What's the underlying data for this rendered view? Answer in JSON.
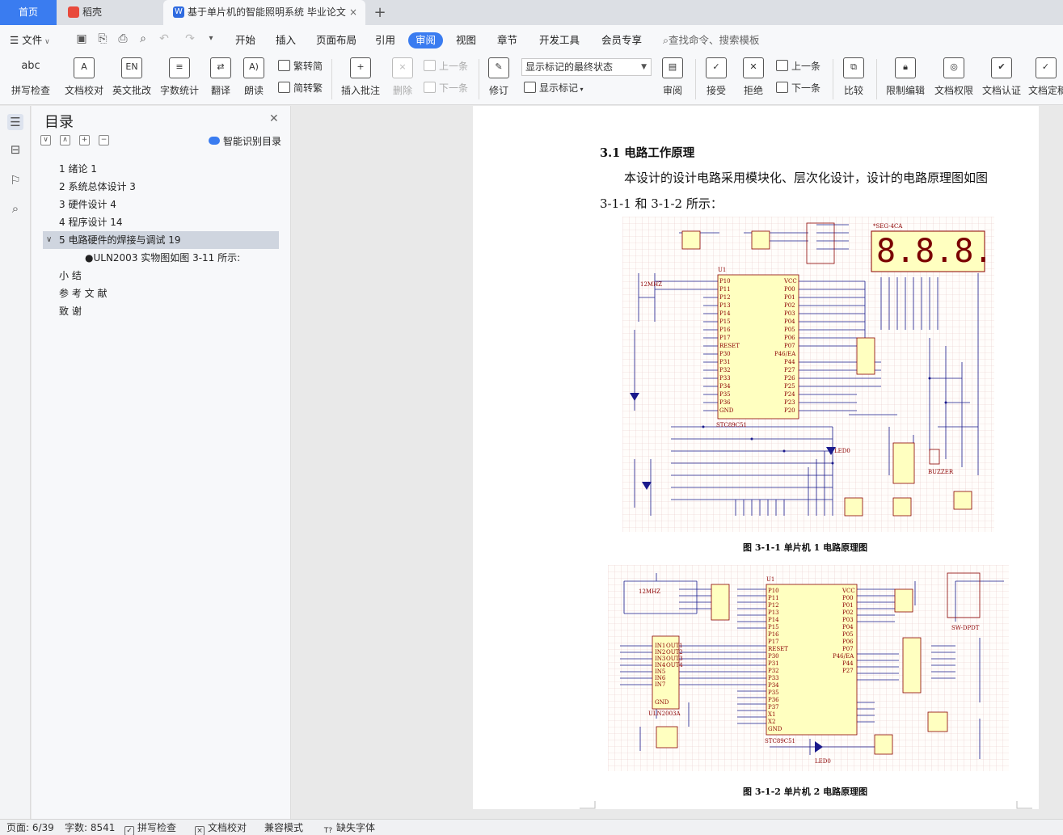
{
  "tabs": {
    "home": "首页",
    "daoke": "稻壳",
    "document": "基于单片机的智能照明系统 毕业论文",
    "close_glyph": "×",
    "add_glyph": "+"
  },
  "menu": {
    "file": "文件",
    "items": [
      "开始",
      "插入",
      "页面布局",
      "引用",
      "审阅",
      "视图",
      "章节",
      "开发工具",
      "会员专享"
    ],
    "active": "审阅",
    "search": "查找命令、搜索模板"
  },
  "ribbon": {
    "spellcheck": "拼写检查",
    "doc_proof": "文档校对",
    "en_proof": "英文批改",
    "word_count": "字数统计",
    "translate": "翻译",
    "read_aloud": "朗读",
    "trad_conv": "繁转简",
    "simp_conv": "简转繁",
    "insert_comment": "插入批注",
    "delete": "删除",
    "prev_comment": "上一条",
    "next_comment": "下一条",
    "revise": "修订",
    "markup_state": "显示标记的最终状态",
    "show_markup": "显示标记",
    "review": "审阅",
    "accept": "接受",
    "reject": "拒绝",
    "prev_change": "上一条",
    "next_change": "下一条",
    "compare": "比较",
    "restrict_edit": "限制编辑",
    "doc_permission": "文档权限",
    "doc_certify": "文档认证",
    "doc_finalize": "文档定稿"
  },
  "toc": {
    "title": "目录",
    "smart_detect": "智能识别目录",
    "items": [
      "1  绪论  1",
      "2  系统总体设计  3",
      "3  硬件设计  4",
      "4  程序设计  14",
      "5  电路硬件的焊接与调试  19",
      "●ULN2003 实物图如图 3-11 所示:",
      "小  结",
      "参  考  文  献",
      "致    谢"
    ]
  },
  "document": {
    "section_title": "3.1 电路工作原理",
    "para_line1": "本设计的设计电路采用模块化、层次化设计，设计的电路原理图如图",
    "para_line2": "3-1-1 和 3-1-2 所示：",
    "figure1_caption": "图 3-1-1  单片机 1 电路原理图",
    "figure2_caption": "图 3-1-2  单片机 2 电路原理图",
    "fig1_labels": {
      "mcu": "STC89C51",
      "seg": "*SEG-4CA",
      "digits": "8.8.8.8",
      "crystal": "12MHZ",
      "buzzer": "BUZZER",
      "led": "LED0"
    },
    "fig2_labels": {
      "mcu": "STC89C51",
      "driver": "ULN2003A",
      "crystal": "12MHZ",
      "switch": "SW-DPDT",
      "led": "LED0"
    }
  },
  "status": {
    "page": "页面: 6/39",
    "words": "字数: 8541",
    "spellcheck": "拼写检查",
    "doc_proof": "文档校对",
    "compat": "兼容模式",
    "missing_fonts": "缺失字体"
  },
  "colors": {
    "accent": "#3a7cf0",
    "schematic_fill": "#ffffc0",
    "schematic_line": "#1a1a8c",
    "schematic_text": "#8b0000"
  }
}
